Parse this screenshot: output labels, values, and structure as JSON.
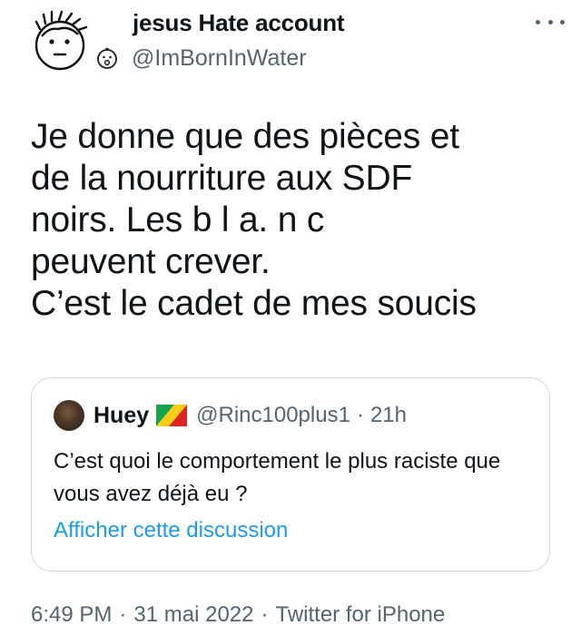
{
  "author": {
    "display_name": "jesus Hate account",
    "handle": "@ImBornInWater"
  },
  "tweet": {
    "text": "Je donne que des pièces et\nde la nourriture aux SDF\nnoirs. Les b   l   a.  n   c\npeuvent crever.\nC’est le cadet de mes soucis"
  },
  "quoted_tweet": {
    "name": "Huey",
    "handle": "@Rinc100plus1",
    "separator": "·",
    "time": "21h",
    "text": "C’est quoi le comportement le plus raciste que vous avez déjà eu ?",
    "link_label": "Afficher cette discussion"
  },
  "meta": {
    "time": "6:49 PM",
    "date": "31 mai 2022",
    "source": "Twitter for iPhone",
    "separator": "·"
  },
  "icons": {
    "more": "more-horizontal-icon",
    "flag": "congo-flag-icon"
  },
  "colors": {
    "link": "#1d9bf0",
    "secondary_text": "#536471",
    "border": "#cfd9de"
  }
}
